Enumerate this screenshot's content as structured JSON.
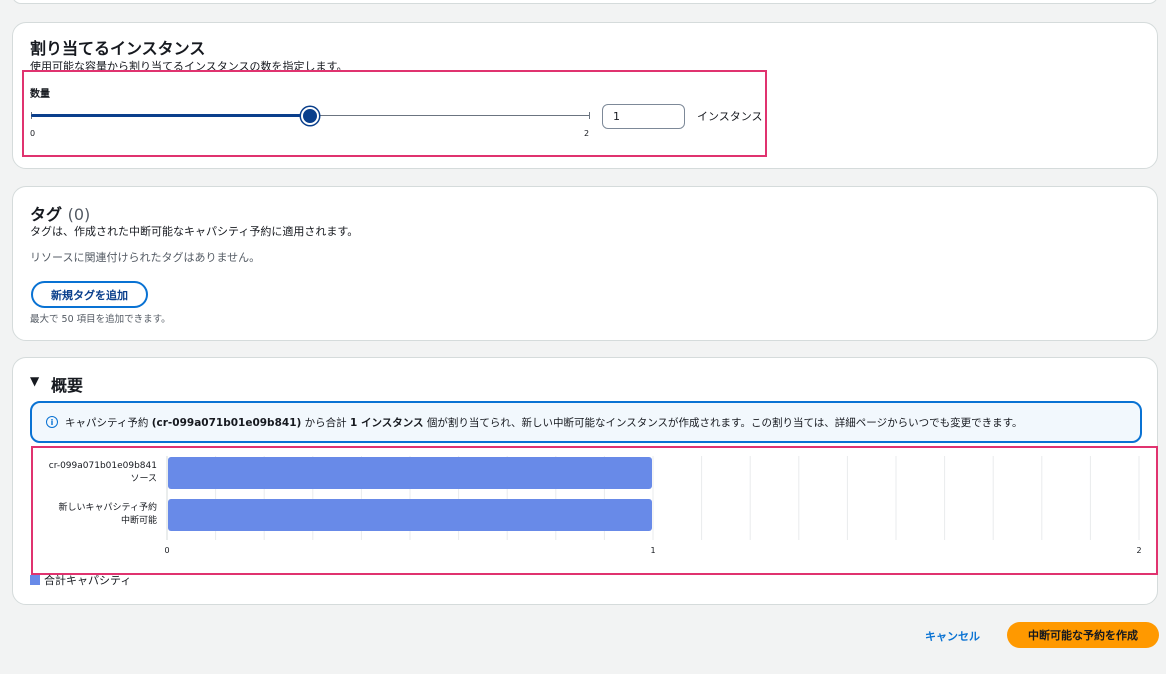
{
  "allocation": {
    "title": "割り当てるインスタンス",
    "description": "使用可能な容量から割り当てるインスタンスの数を指定します。",
    "quantity_label": "数量",
    "slider_min_label": "0",
    "slider_max_label": "2",
    "slider_value": 1,
    "slider_min": 0,
    "slider_max": 2,
    "input_value": "1",
    "unit_label": "インスタンス"
  },
  "tags": {
    "title": "タグ",
    "count": "(0)",
    "description": "タグは、作成された中断可能なキャパシティ予約に適用されます。",
    "empty_text": "リソースに関連付けられたタグはありません。",
    "add_button": "新規タグを追加",
    "limit_text": "最大で 50 項目を追加できます。"
  },
  "summary": {
    "title": "概要",
    "info": {
      "part1": "キャパシティ予約 ",
      "reservation_id": "(cr-099a071b01e09b841)",
      "part2": " から合計 ",
      "count_text": "1 インスタンス",
      "part3": " 個が割り当てられ、新しい中断可能なインスタンスが作成されます。この割り当ては、詳細ページからいつでも変更できます。"
    },
    "legend": "合計キャパシティ"
  },
  "chart_data": {
    "type": "bar",
    "orientation": "horizontal",
    "categories": [
      [
        "cr-099a071b01e09b841",
        "ソース"
      ],
      [
        "新しいキャパシティ予約",
        "中断可能"
      ]
    ],
    "series": [
      {
        "name": "合計キャパシティ",
        "values": [
          1,
          1
        ],
        "color": "#688ae8"
      }
    ],
    "x_ticks": [
      "0",
      "1",
      "2"
    ],
    "xlim": [
      0,
      2
    ],
    "grid": true,
    "legend_position": "bottom-left"
  },
  "footer": {
    "cancel": "キャンセル",
    "create": "中断可能な予約を作成"
  },
  "colors": {
    "accent": "#0972d3",
    "primary_button": "#ff9900",
    "highlight": "#e0336f",
    "bar": "#688ae8"
  }
}
